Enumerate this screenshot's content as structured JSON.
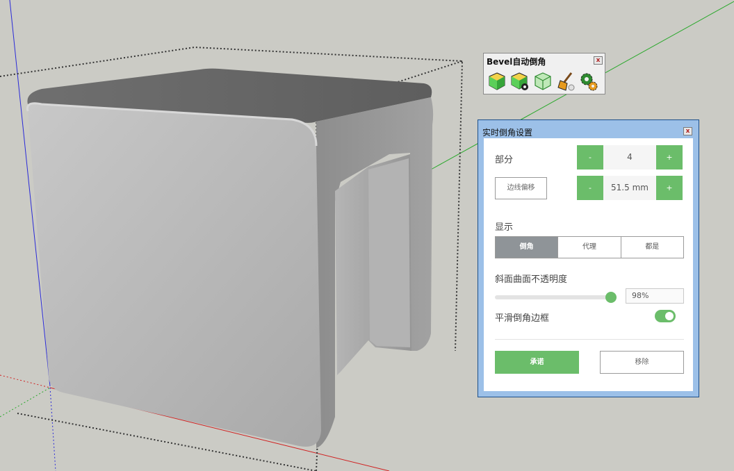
{
  "toolbar": {
    "title": "Bevel自动倒角",
    "close": "x",
    "icons": [
      "bevel-cube-icon",
      "bevel-cube-settings-icon",
      "bevel-cube-outline-icon",
      "broom-clean-icon",
      "settings-gears-icon"
    ]
  },
  "dialog": {
    "title": "实时倒角设置",
    "close": "x",
    "segments_label": "部分",
    "segments_minus": "-",
    "segments_value": "4",
    "segments_plus": "+",
    "edge_offset_button": "边线偏移",
    "offset_minus": "-",
    "offset_value": "51.5 mm",
    "offset_plus": "+",
    "display_label": "显示",
    "display_tabs": [
      "倒角",
      "代理",
      "都是"
    ],
    "opacity_label": "斜面曲面不透明度",
    "opacity_percent": 98,
    "opacity_text": "98%",
    "smooth_label": "平滑倒角边框",
    "smooth_on": true,
    "commit_button": "承诺",
    "remove_button": "移除"
  },
  "colors": {
    "accent": "#6bbd6a",
    "active_tab": "#8f9498",
    "viewport_bg": "#cbcbc5"
  }
}
